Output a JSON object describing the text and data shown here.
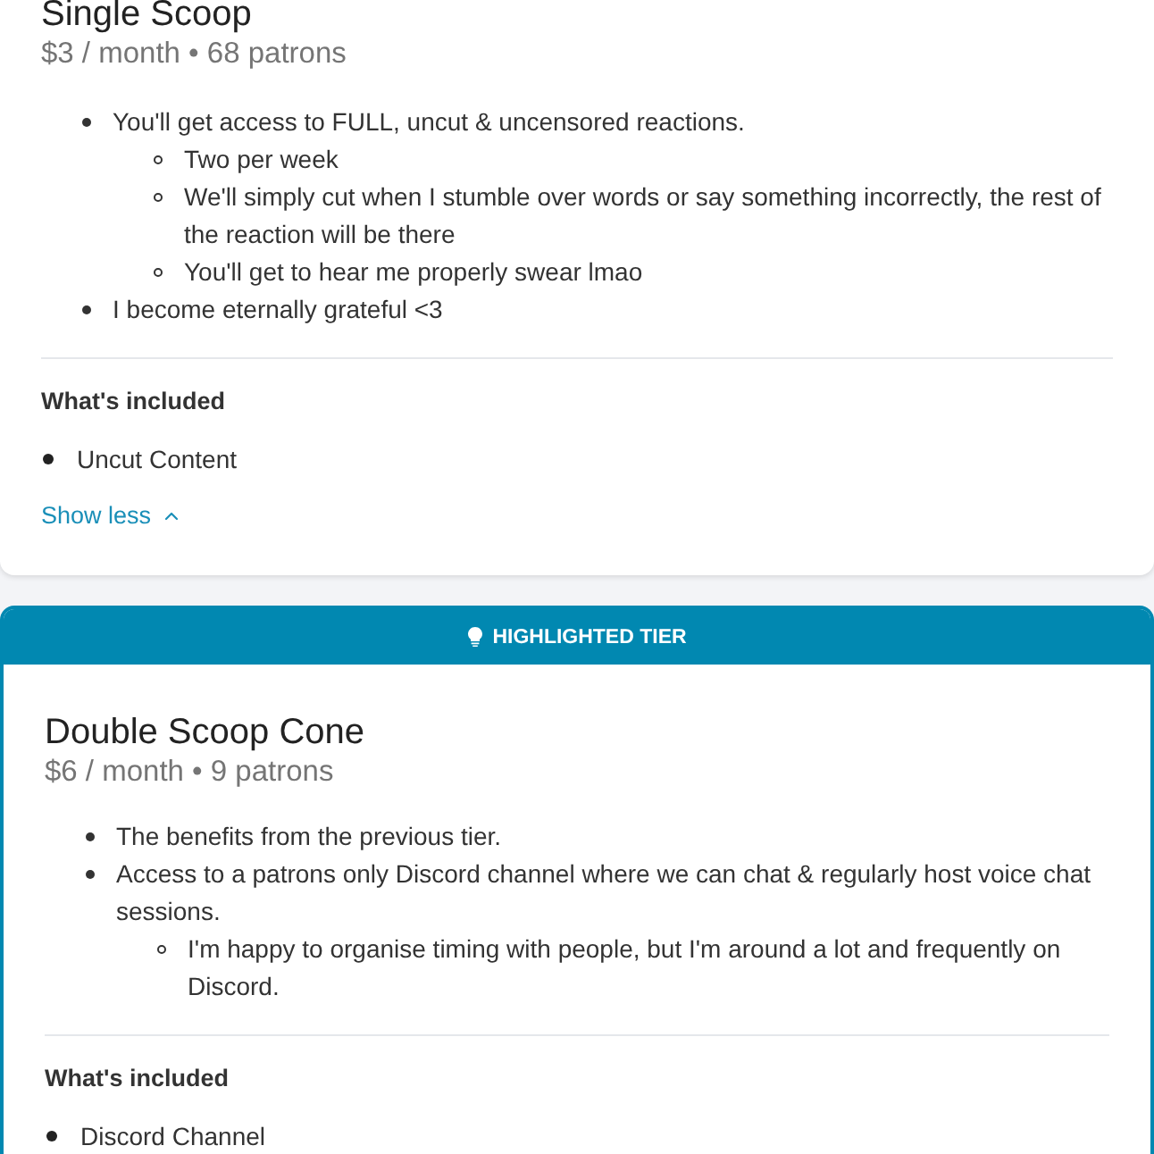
{
  "tiers": [
    {
      "highlighted": false,
      "title": "Single Scoop",
      "price": "$3 / month • 68 patrons",
      "benefits": [
        {
          "text": "You'll get access to FULL, uncut & uncensored reactions.",
          "children": [
            {
              "text": "Two per week"
            },
            {
              "text": "We'll simply cut when I stumble over words or say something incorrectly, the rest of the reaction will be there"
            },
            {
              "text": "You'll get to hear me properly swear lmao"
            }
          ]
        },
        {
          "text": "I become eternally grateful <3"
        }
      ],
      "included_heading": "What's included",
      "included": [
        "Uncut Content"
      ],
      "toggle": {
        "label": "Show less",
        "expanded": true
      }
    },
    {
      "highlighted": true,
      "banner": "HIGHLIGHTED TIER",
      "title": "Double Scoop Cone",
      "price": "$6 / month • 9 patrons",
      "benefits": [
        {
          "text": "The benefits from the previous tier."
        },
        {
          "text": "Access to a patrons only Discord channel where we can chat & regularly host voice chat sessions.",
          "children": [
            {
              "text": "I'm happy to organise timing with people, but I'm around a lot and frequently on Discord."
            }
          ]
        }
      ],
      "included_heading": "What's included",
      "included": [
        "Discord Channel"
      ]
    }
  ]
}
